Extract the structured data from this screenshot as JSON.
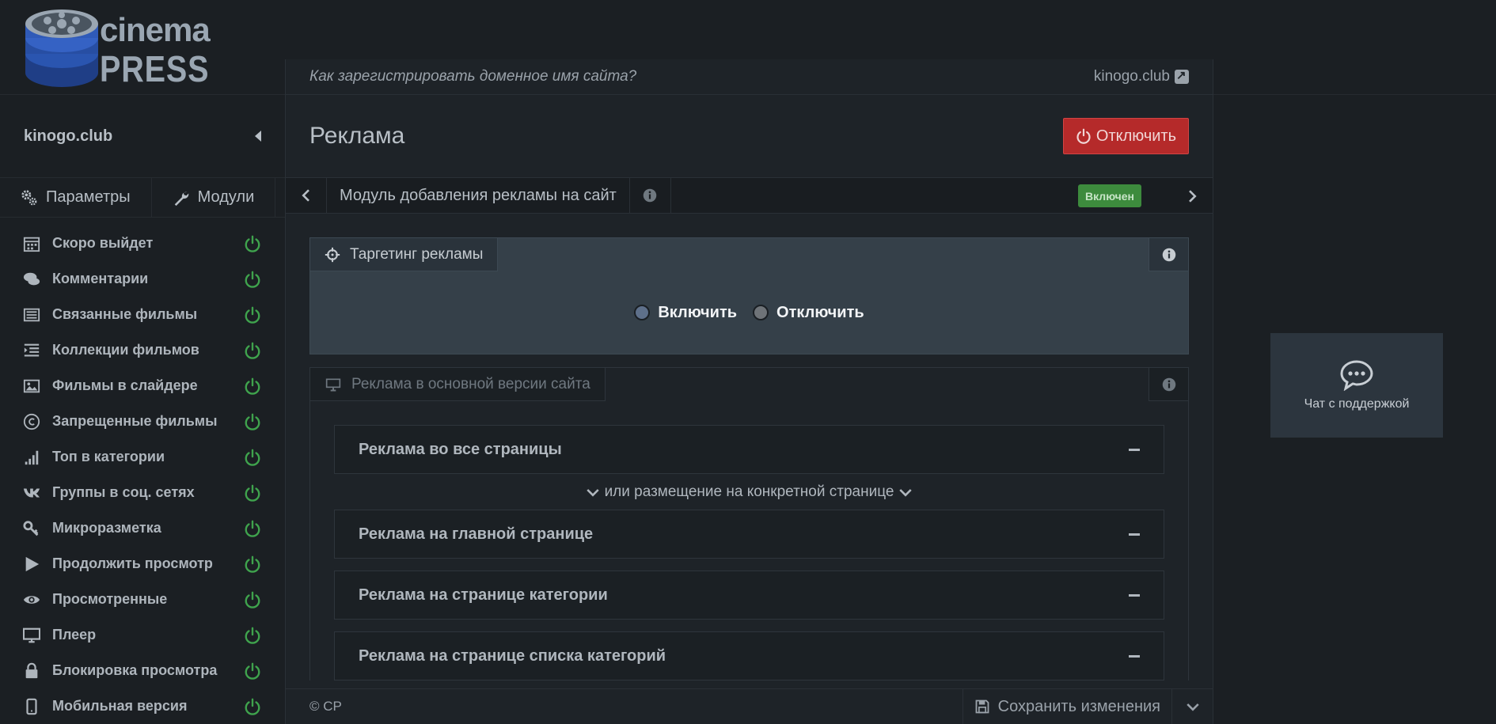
{
  "logo": {
    "line1": "cinema",
    "line2": "PRESS"
  },
  "sidebar": {
    "site": "kinogo.club",
    "tabs": [
      {
        "label": "Параметры",
        "icon": "gears-icon"
      },
      {
        "label": "Модули",
        "icon": "wrench-icon"
      }
    ],
    "items": [
      {
        "label": "Скоро выйдет",
        "icon": "calendar-icon"
      },
      {
        "label": "Комментарии",
        "icon": "comments-icon"
      },
      {
        "label": "Связанные фильмы",
        "icon": "list-alt-icon"
      },
      {
        "label": "Коллекции фильмов",
        "icon": "indent-icon"
      },
      {
        "label": "Фильмы в слайдере",
        "icon": "picture-icon"
      },
      {
        "label": "Запрещенные фильмы",
        "icon": "copyright-icon"
      },
      {
        "label": "Топ в категории",
        "icon": "signal-icon"
      },
      {
        "label": "Группы в соц. сетях",
        "icon": "vk-icon"
      },
      {
        "label": "Микроразметка",
        "icon": "key-icon"
      },
      {
        "label": "Продолжить просмотр",
        "icon": "play-icon"
      },
      {
        "label": "Просмотренные",
        "icon": "eye-icon"
      },
      {
        "label": "Плеер",
        "icon": "monitor-icon"
      },
      {
        "label": "Блокировка просмотра",
        "icon": "lock-icon"
      },
      {
        "label": "Мобильная версия",
        "icon": "mobile-icon"
      }
    ]
  },
  "helpbar": {
    "help_link": "Как зарегистрировать доменное имя сайта?",
    "domain": "kinogo.club"
  },
  "page": {
    "title": "Реклама",
    "disable_button": "Отключить"
  },
  "module": {
    "title": "Модуль добавления рекламы на сайт",
    "status": "Включен"
  },
  "targeting": {
    "tab": "Таргетинг рекламы",
    "options": [
      "Включить",
      "Отключить"
    ]
  },
  "ads": {
    "tab": "Реклама в основной версии сайта",
    "all_pages": "Реклама во все страницы",
    "divider": "или размещение на конкретной странице",
    "sections": [
      "Реклама на главной странице",
      "Реклама на странице категории",
      "Реклама на странице списка категорий"
    ]
  },
  "footer": {
    "copyright": "© CP",
    "save": "Сохранить изменения"
  },
  "chat": {
    "label": "Чат с поддержкой"
  },
  "colors": {
    "accent_green": "#3fa34d",
    "danger": "#b52a2a",
    "badge_green": "#3d8b3d"
  }
}
